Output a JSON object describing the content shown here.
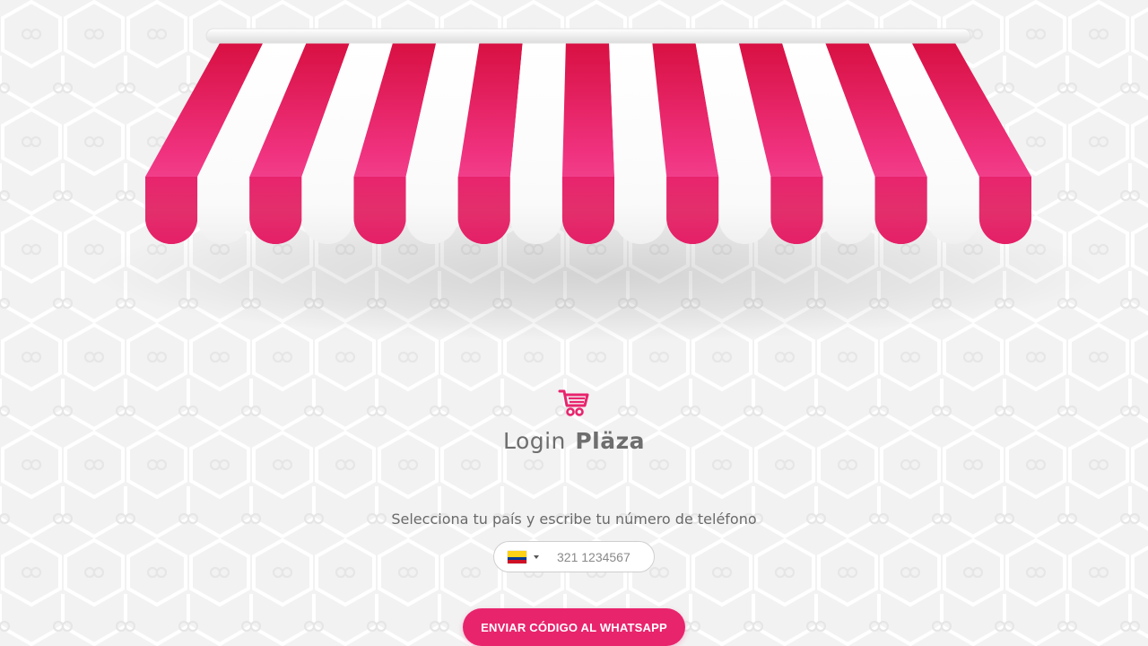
{
  "colors": {
    "background": "#f2f2f2",
    "accent": "#e8246d",
    "stripe_pink": "#ec2a7a",
    "stripe_white": "#ffffff",
    "text_gray": "#6e6e6e"
  },
  "awning": {
    "stripe_colors": [
      "pink",
      "white"
    ]
  },
  "login": {
    "icon": "shopping-cart-icon",
    "title_prefix": "Login",
    "title_brand": "Pläza",
    "instructions": "Selecciona tu país y escribe tu número de teléfono"
  },
  "phone": {
    "country_flag": "colombia-flag-icon",
    "placeholder": "321 1234567",
    "value": ""
  },
  "actions": {
    "send_label": "ENVIAR CÓDIGO AL WHATSAPP"
  }
}
